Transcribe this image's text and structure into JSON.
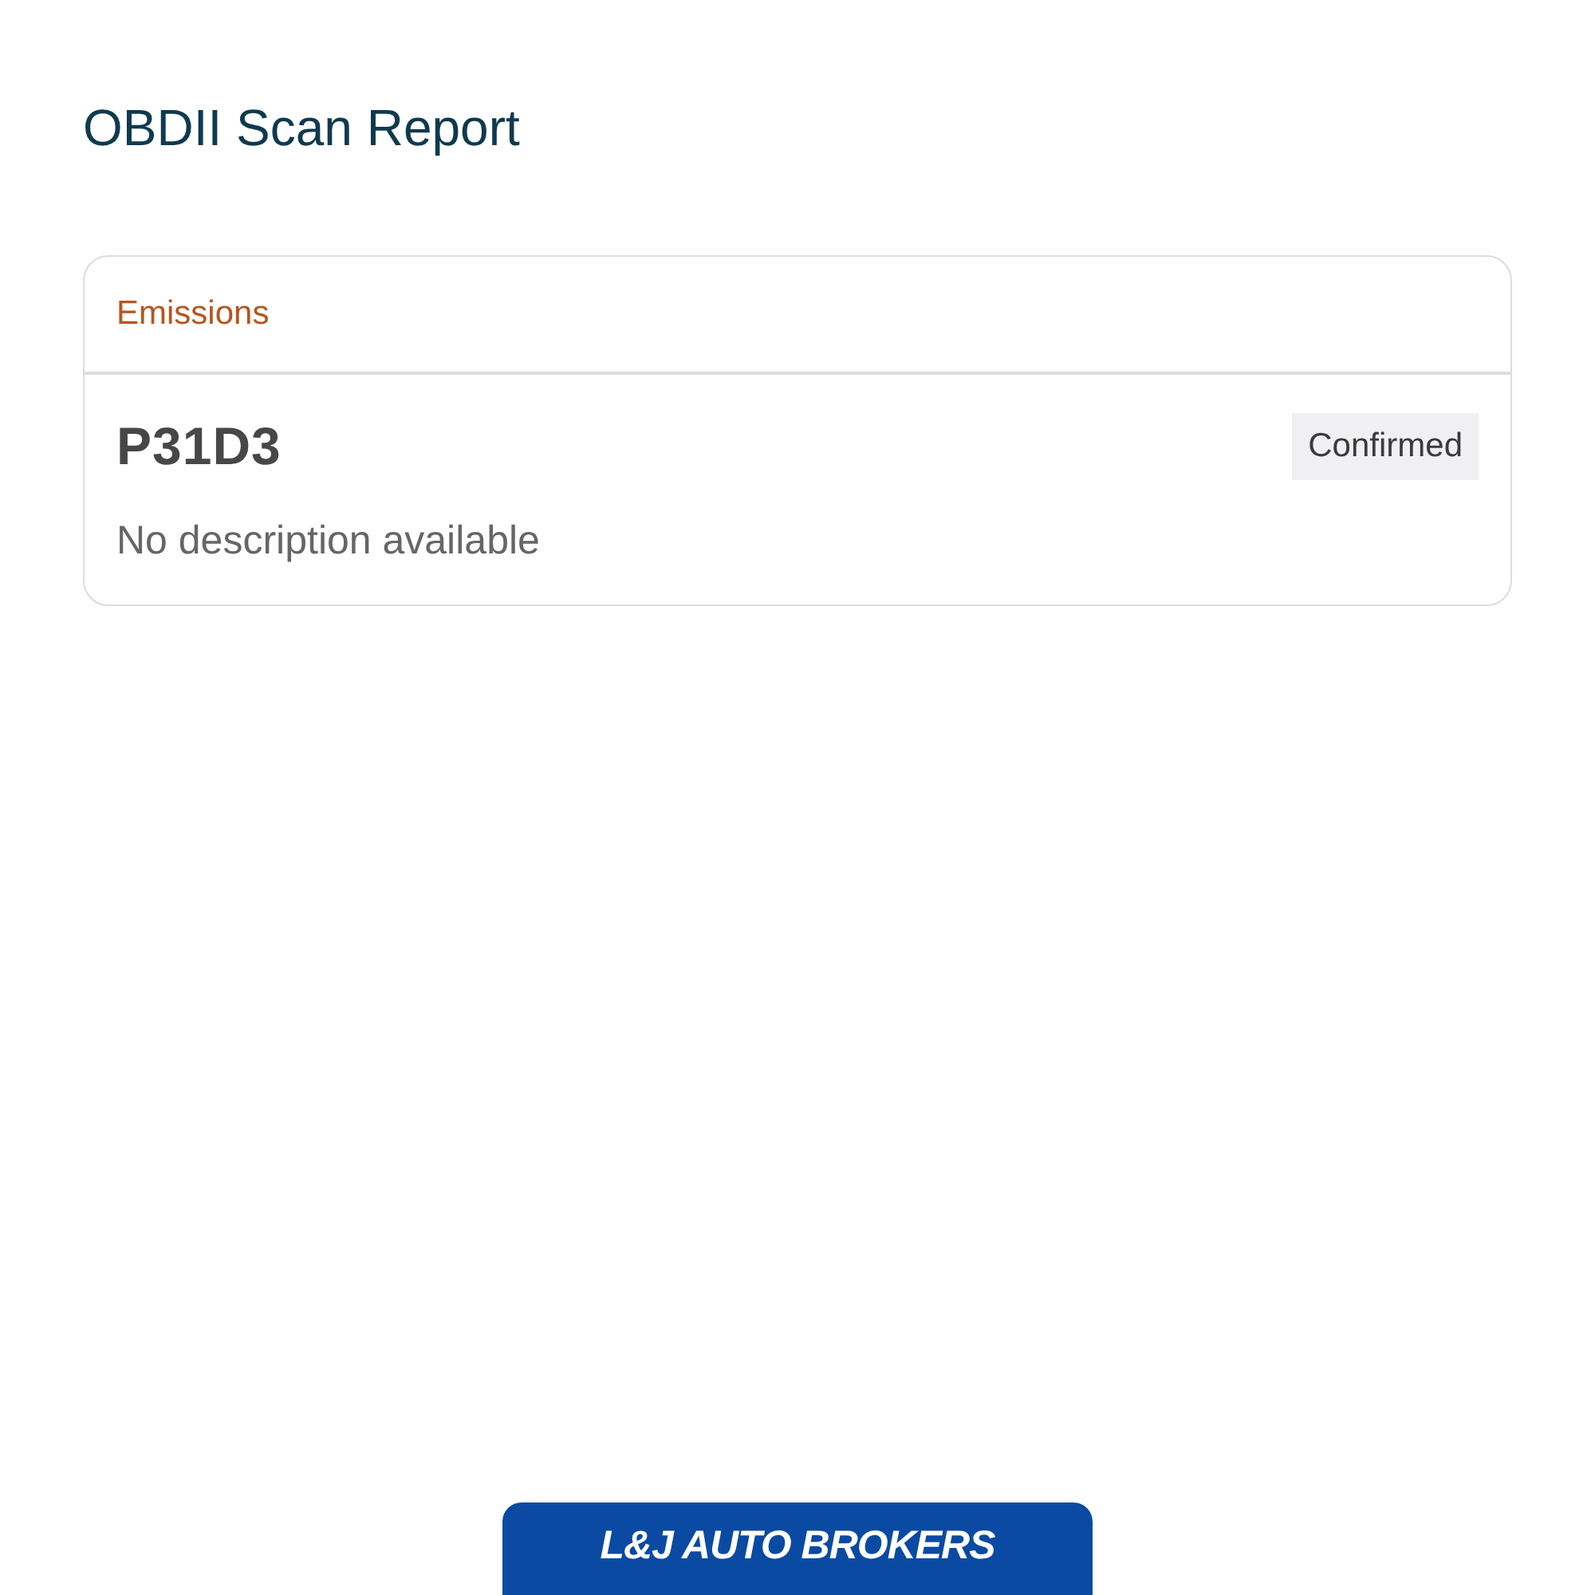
{
  "title": "OBDII Scan Report",
  "sections": [
    {
      "heading": "Emissions",
      "codes": [
        {
          "code": "P31D3",
          "status": "Confirmed",
          "description": "No description available"
        }
      ]
    }
  ],
  "footer": {
    "logo_text": "L&J AUTO BROKERS"
  }
}
